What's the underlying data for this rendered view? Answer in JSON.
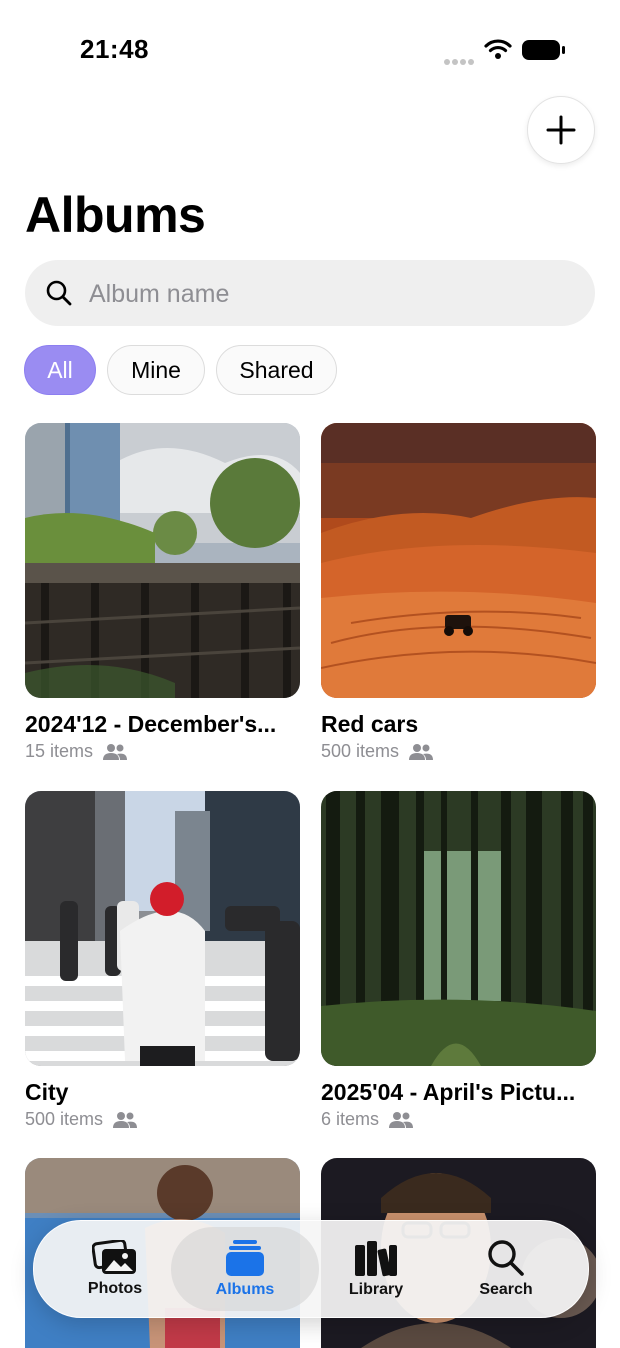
{
  "status_bar": {
    "time": "21:48"
  },
  "header": {
    "title": "Albums",
    "add_button": "plus-icon"
  },
  "search": {
    "placeholder": "Album name",
    "value": ""
  },
  "filters": [
    {
      "label": "All",
      "selected": true
    },
    {
      "label": "Mine",
      "selected": false
    },
    {
      "label": "Shared",
      "selected": false
    }
  ],
  "albums": [
    {
      "name": "2024'12 - December's...",
      "count": "15 items",
      "shared_icon": "people-icon"
    },
    {
      "name": "Red cars",
      "count": "500 items",
      "shared_icon": "people-icon"
    },
    {
      "name": "City",
      "count": "500 items",
      "shared_icon": "people-icon"
    },
    {
      "name": "2025'04 - April's Pictu...",
      "count": "6 items",
      "shared_icon": "people-icon"
    }
  ],
  "tabbar": {
    "items": [
      {
        "label": "Photos",
        "icon": "photos-icon"
      },
      {
        "label": "Albums",
        "icon": "albums-icon",
        "selected": true
      },
      {
        "label": "Library",
        "icon": "library-icon"
      },
      {
        "label": "Search",
        "icon": "search-icon"
      }
    ]
  },
  "colors": {
    "accent": "#9a8cf2",
    "tab_selected": "#1b73e8",
    "secondary_text": "#8e8e93"
  }
}
